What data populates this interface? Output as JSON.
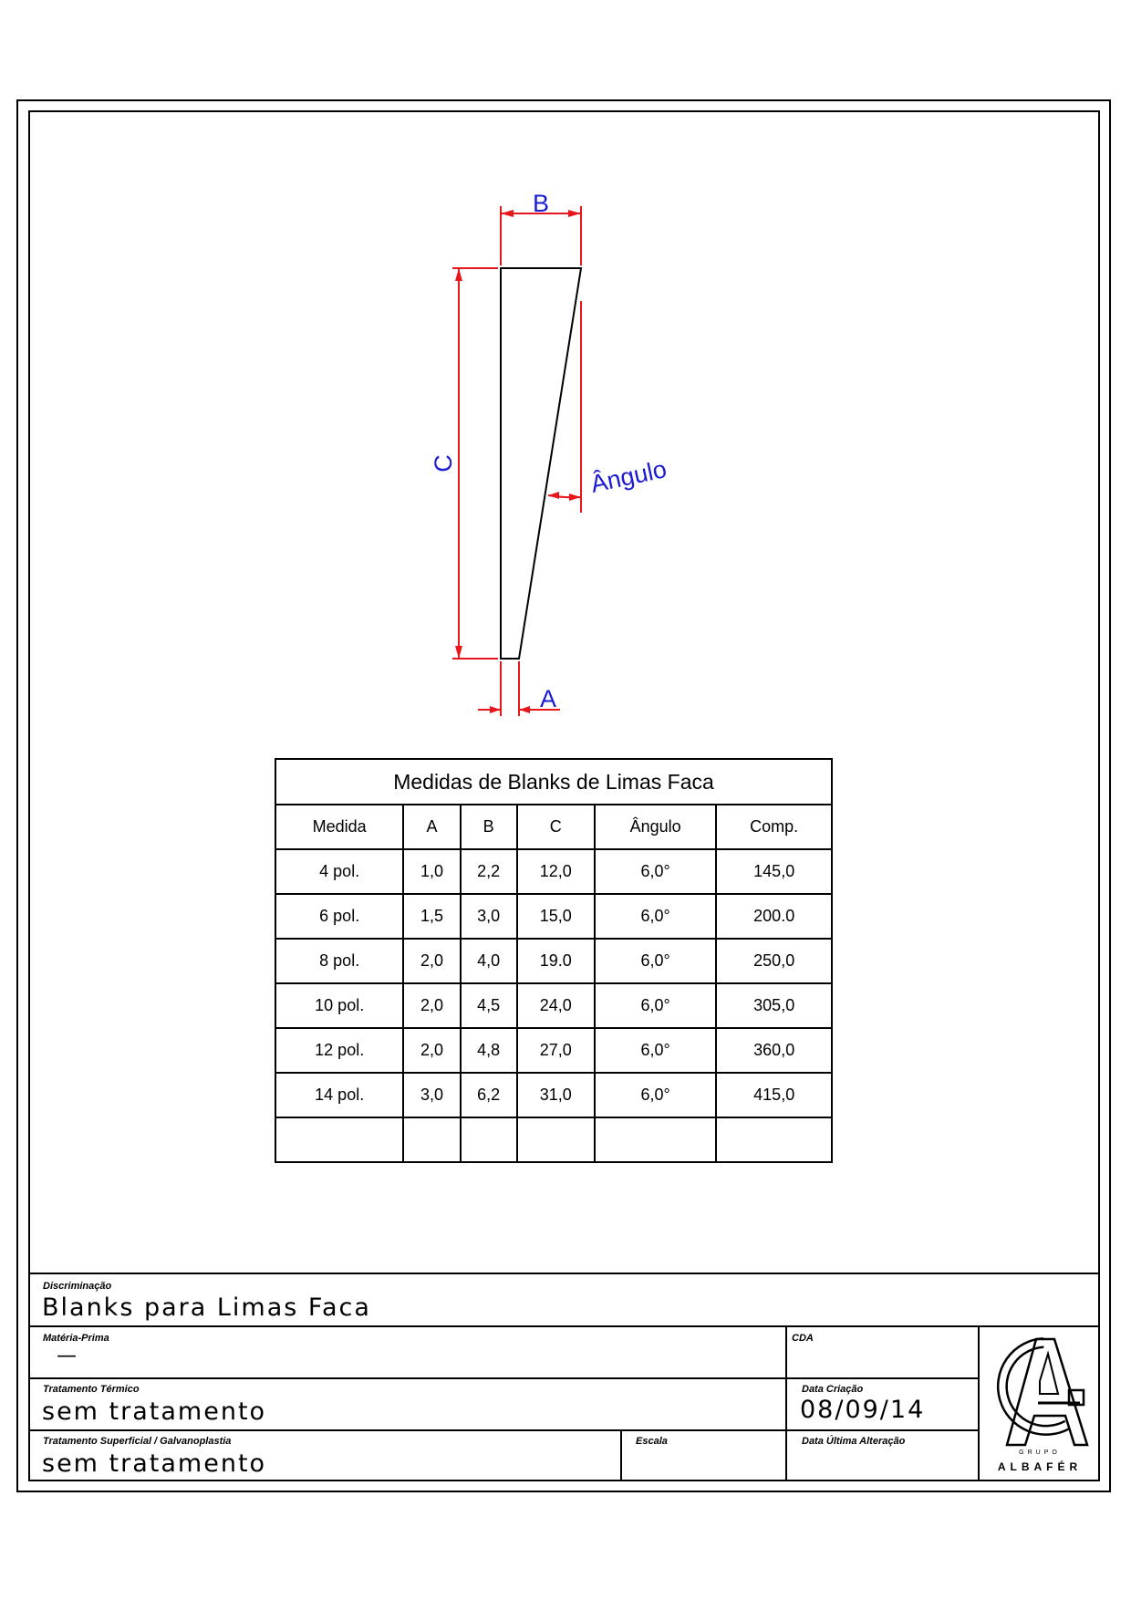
{
  "drawing": {
    "dimension_labels": {
      "b": "B",
      "c": "C",
      "a": "A",
      "angle": "Ângulo"
    },
    "colors": {
      "dimension_line": "#e8151b",
      "dimension_text": "#1b1bd6",
      "outline": "#000000"
    }
  },
  "table": {
    "title": "Medidas de Blanks de Limas Faca",
    "headers": [
      "Medida",
      "A",
      "B",
      "C",
      "Ângulo",
      "Comp."
    ],
    "rows": [
      [
        "4 pol.",
        "1,0",
        "2,2",
        "12,0",
        "6,0°",
        "145,0"
      ],
      [
        "6 pol.",
        "1,5",
        "3,0",
        "15,0",
        "6,0°",
        "200.0"
      ],
      [
        "8 pol.",
        "2,0",
        "4,0",
        "19.0",
        "6,0°",
        "250,0"
      ],
      [
        "10 pol.",
        "2,0",
        "4,5",
        "24,0",
        "6,0°",
        "305,0"
      ],
      [
        "12 pol.",
        "2,0",
        "4,8",
        "27,0",
        "6,0°",
        "360,0"
      ],
      [
        "14 pol.",
        "3,0",
        "6,2",
        "31,0",
        "6,0°",
        "415,0"
      ],
      [
        "",
        "",
        "",
        "",
        "",
        ""
      ]
    ]
  },
  "title_block": {
    "discriminacao_label": "Discriminação",
    "discriminacao_value": "Blanks para Limas Faca",
    "materia_prima_label": "Matéria-Prima",
    "materia_prima_value": "—",
    "cda_label": "CDA",
    "tratamento_termico_label": "Tratamento Térmico",
    "tratamento_termico_value": "sem tratamento",
    "data_criacao_label": "Data Criação",
    "data_criacao_value": "08/09/14",
    "tratamento_superficial_label": "Tratamento Superficial / Galvanoplastia",
    "tratamento_superficial_value": "sem tratamento",
    "escala_label": "Escala",
    "data_ultima_alteracao_label": "Data Última Alteração",
    "logo_top_text": "GRUPO",
    "logo_text": "ALBAFÉR"
  }
}
